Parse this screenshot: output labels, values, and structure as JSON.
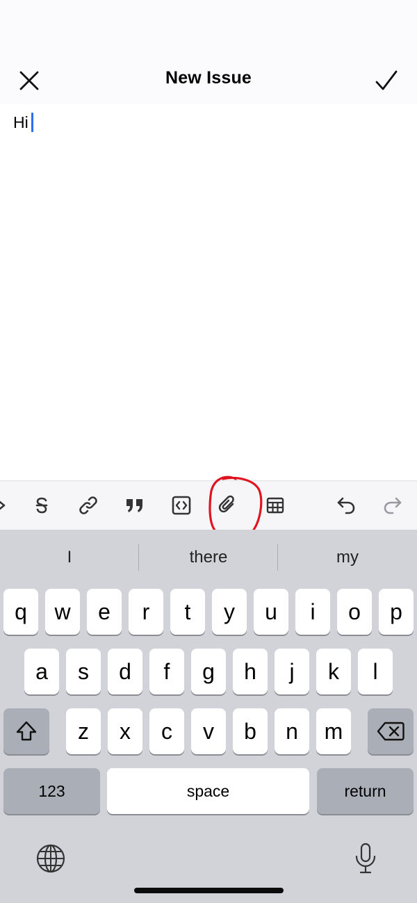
{
  "nav": {
    "title": "New Issue"
  },
  "editor": {
    "text": "Hi"
  },
  "toolbar": {
    "buttons": [
      "chevron-right-icon",
      "strikethrough-icon",
      "link-icon",
      "quote-icon",
      "code-icon",
      "attachment-icon",
      "table-icon",
      "undo-icon",
      "redo-icon"
    ],
    "annotation_color": "#e0141e"
  },
  "keyboard": {
    "suggestions": [
      "I",
      "there",
      "my"
    ],
    "rows": [
      [
        "q",
        "w",
        "e",
        "r",
        "t",
        "y",
        "u",
        "i",
        "o",
        "p"
      ],
      [
        "a",
        "s",
        "d",
        "f",
        "g",
        "h",
        "j",
        "k",
        "l"
      ],
      [
        "z",
        "x",
        "c",
        "v",
        "b",
        "n",
        "m"
      ]
    ],
    "numbers_label": "123",
    "space_label": "space",
    "return_label": "return"
  },
  "colors": {
    "accent_caret": "#2a6ff0",
    "keyboard_bg": "#d1d3d9",
    "dark_key": "#aaaeb6"
  }
}
